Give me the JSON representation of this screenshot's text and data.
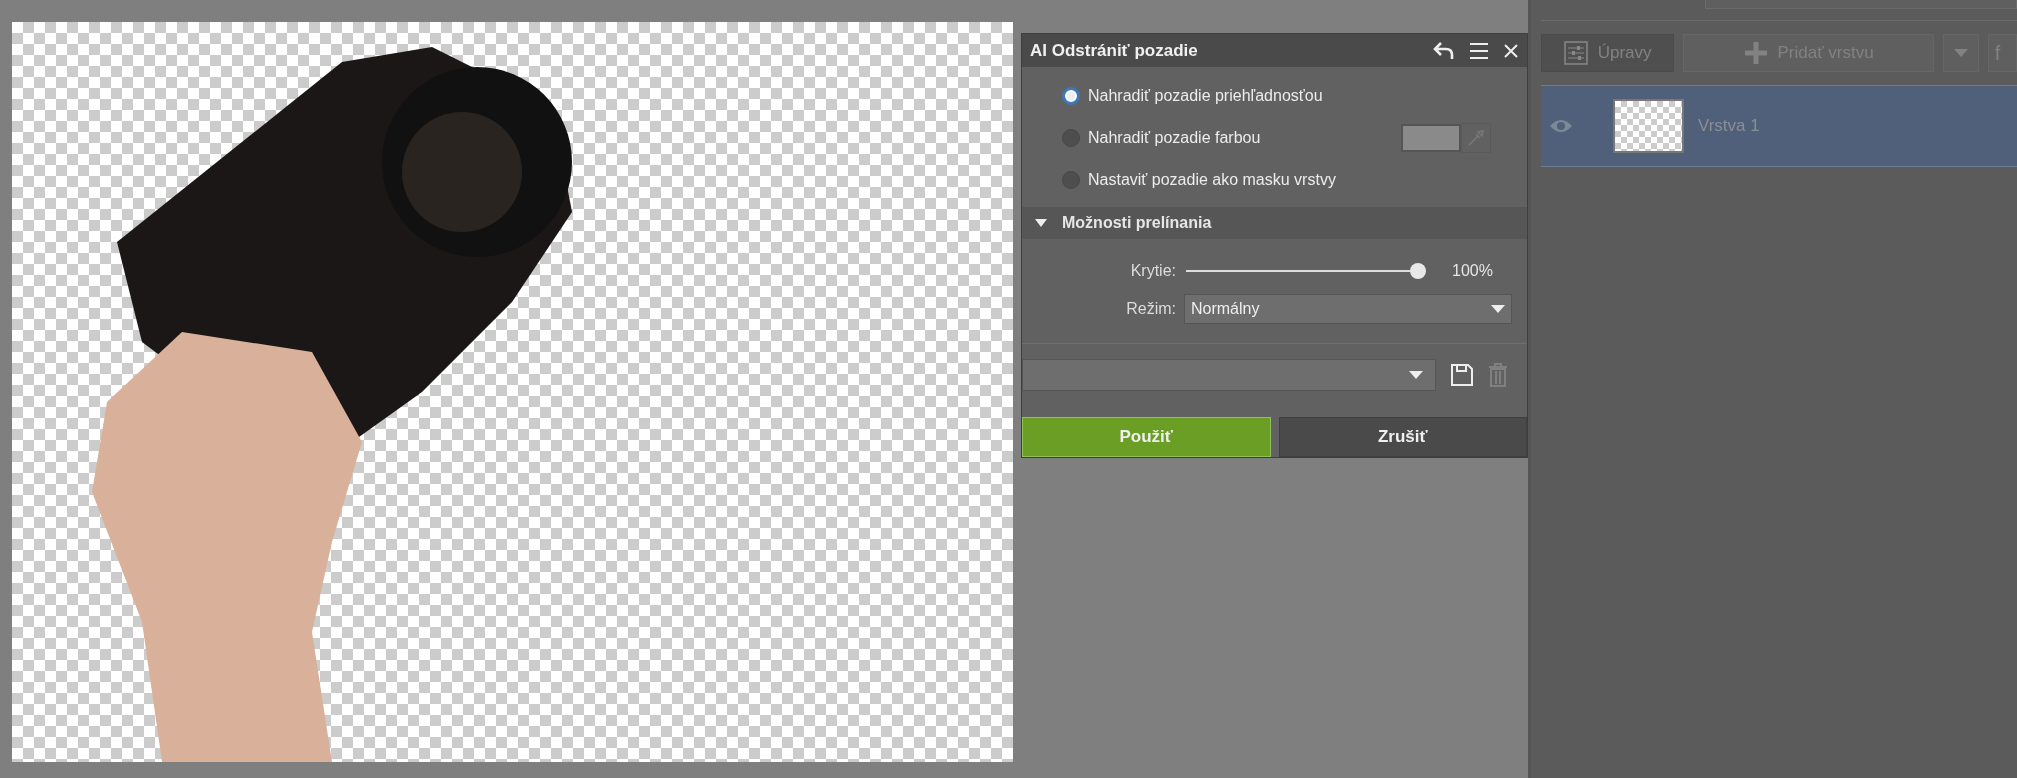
{
  "dialog": {
    "title": "AI Odstrániť pozadie",
    "options": [
      {
        "label": "Nahradiť pozadie priehľadnosťou",
        "selected": true,
        "kind": "plain"
      },
      {
        "label": "Nahradiť pozadie farbou",
        "selected": false,
        "kind": "color"
      },
      {
        "label": "Nastaviť pozadie ako masku vrstvy",
        "selected": false,
        "kind": "plain"
      }
    ],
    "section": {
      "title": "Možnosti prelínania",
      "expanded": true
    },
    "opacity": {
      "label": "Krytie:",
      "level": 1.0,
      "reading": "100%"
    },
    "mode": {
      "label": "Režim:",
      "value": "Normálny"
    },
    "buttons": [
      {
        "label": "Použiť",
        "kind": "primary"
      },
      {
        "label": "Zrušiť",
        "kind": "secondary"
      }
    ]
  },
  "layers_panel": {
    "adjustments_button": "Úpravy",
    "add_layer_button": "Pridať vrstvu",
    "fx_button": "f",
    "layers": [
      {
        "name": "Vrstva 1",
        "selected": true,
        "visible": true
      }
    ]
  }
}
